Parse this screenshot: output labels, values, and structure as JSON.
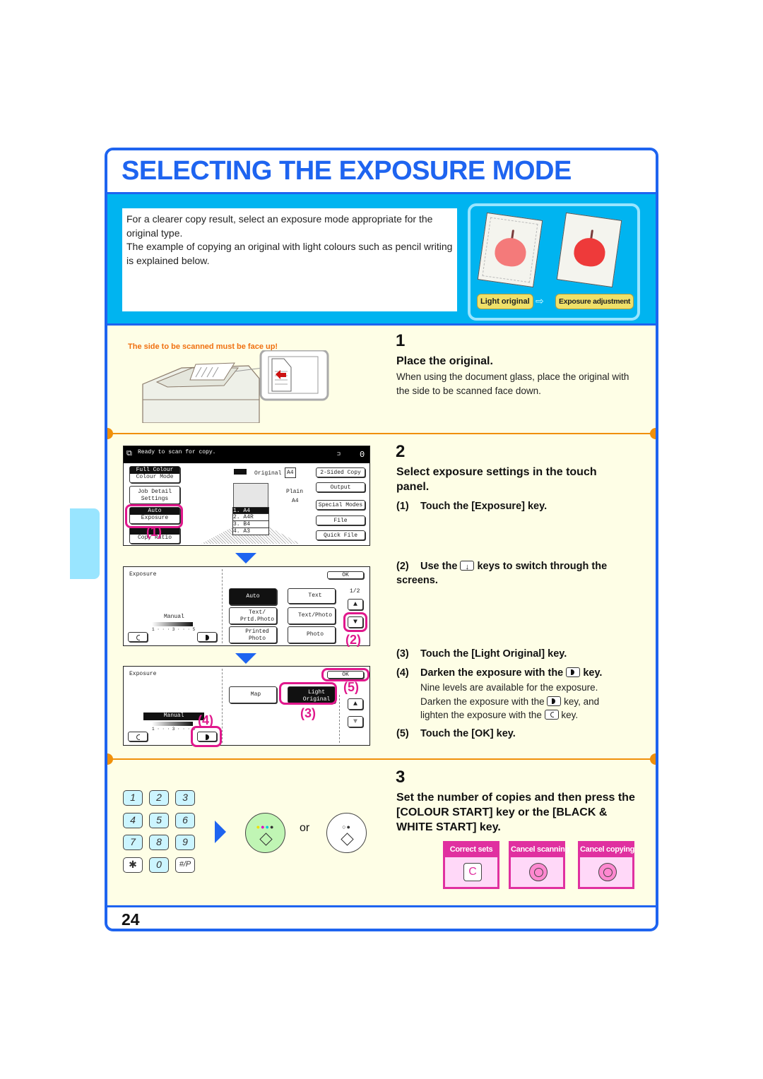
{
  "page": {
    "title": "SELECTING THE EXPOSURE MODE",
    "page_number": "24",
    "colors": {
      "accent_blue": "#1e64f0",
      "intro_bg": "#00b4f0",
      "step_bg": "#fefee6",
      "separator": "#f0900a",
      "highlight": "#e0188c",
      "warning": "#f07010"
    }
  },
  "intro": {
    "paragraph1": "For a clearer copy result, select an exposure mode appropriate for the original type.",
    "paragraph2": "The example of copying an original with light colours such as pencil writing is explained below.",
    "illustration": {
      "label_before": "Light original",
      "label_after": "Exposure adjustment",
      "arrow": "⇨"
    }
  },
  "step1": {
    "number": "1",
    "title": "Place the original.",
    "description": "When using the document glass, place the original with the side to be scanned face down.",
    "warning": "The side to be scanned must be face up!"
  },
  "step2": {
    "number": "2",
    "title": "Select exposure settings in the touch panel.",
    "substeps": [
      {
        "n": "(1)",
        "text": "Touch the [Exposure] key."
      },
      {
        "n": "(2)",
        "pre": "Use the",
        "post": "keys to switch through the screens."
      },
      {
        "n": "(3)",
        "text": "Touch the [Light Original] key."
      },
      {
        "n": "(4)",
        "pre": "Darken the exposure with the",
        "post": "key."
      },
      {
        "n": "(5)",
        "text": "Touch the [OK] key."
      }
    ],
    "substep4_desc": {
      "line1": "Nine levels are available for the exposure.",
      "line2_pre": "Darken the exposure with the",
      "line2_post": "key, and",
      "line3_pre": "lighten the exposure with the",
      "line3_post": "key."
    },
    "callouts": [
      "(1)",
      "(2)",
      "(3)",
      "(4)",
      "(5)"
    ]
  },
  "screen1": {
    "status": "Ready to scan for copy.",
    "count": "0",
    "left_buttons": [
      {
        "top": "Full Colour",
        "bottom": "Colour Mode"
      },
      {
        "top": "Job Detail",
        "bottom": "Settings"
      },
      {
        "top": "Auto",
        "bottom": "Exposure"
      },
      {
        "top": "",
        "bottom": "Copy Ratio"
      }
    ],
    "original_label": "Original",
    "original_size": "A4",
    "paper_type": "Plain",
    "paper_size": "A4",
    "trays": [
      "1.  A4",
      "2.  A4R",
      "3.  B4",
      "4.  A3"
    ],
    "right_buttons": [
      "2-Sided Copy",
      "Output",
      "Special Modes",
      "File",
      "Quick File"
    ]
  },
  "screen2": {
    "title": "Exposure",
    "ok": "OK",
    "page_indicator": "1/2",
    "manual_label": "Manual",
    "scale": "1 · · · 3 · · · 5",
    "modes": [
      {
        "label": "Auto",
        "selected": true
      },
      {
        "label": "Text",
        "selected": false
      },
      {
        "label": "Text/ Prtd.Photo",
        "selected": false
      },
      {
        "label": "Text/Photo",
        "selected": false
      },
      {
        "label": "Printed Photo",
        "selected": false
      },
      {
        "label": "Photo",
        "selected": false
      }
    ]
  },
  "screen3": {
    "title": "Exposure",
    "ok": "OK",
    "manual_label": "Manual",
    "scale": "1 · · · 3 · · · 5",
    "modes": [
      {
        "label": "Map",
        "selected": false
      },
      {
        "label": "Light Original",
        "selected": true
      }
    ]
  },
  "step3": {
    "number": "3",
    "title": "Set the number of copies and then press the [COLOUR START] key or the [BLACK & WHITE START] key.",
    "keypad": [
      "1",
      "2",
      "3",
      "4",
      "5",
      "6",
      "7",
      "8",
      "9",
      "✱",
      "0",
      "#/P"
    ],
    "or_label": "or",
    "cards": [
      {
        "label": "Correct sets",
        "icon": "C"
      },
      {
        "label": "Cancel scanning",
        "icon": "stop"
      },
      {
        "label": "Cancel copying",
        "icon": "stop"
      }
    ]
  }
}
